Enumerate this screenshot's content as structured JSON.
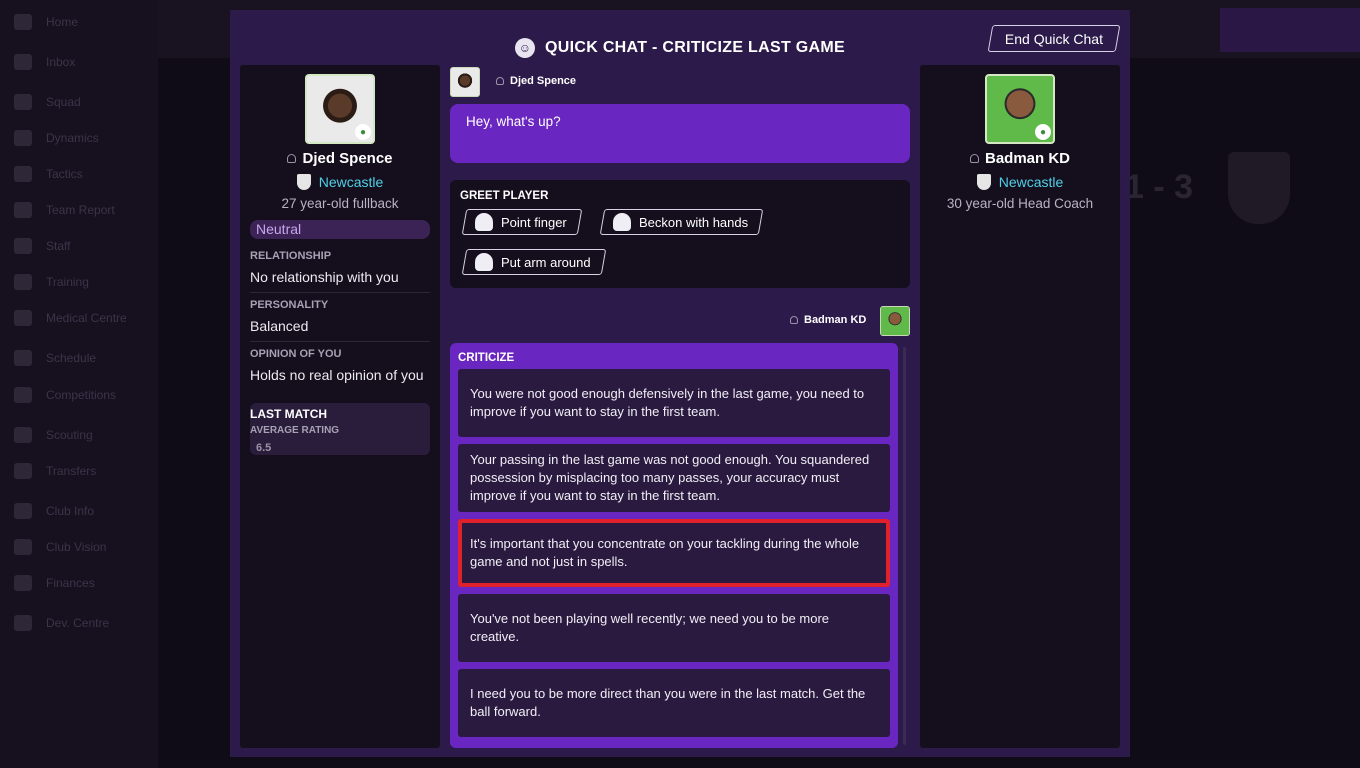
{
  "background": {
    "nav_items": [
      "Home",
      "Inbox",
      "Squad",
      "Dynamics",
      "Tactics",
      "Team Report",
      "Staff",
      "Training",
      "Medical Centre",
      "Schedule",
      "Competitions",
      "Scouting",
      "Transfers",
      "Club Info",
      "Club Vision",
      "Finances",
      "Dev. Centre"
    ],
    "score": "1 - 3"
  },
  "modal": {
    "title": "QUICK CHAT - CRITICIZE LAST GAME",
    "end_button": "End Quick Chat"
  },
  "player": {
    "name": "Djed Spence",
    "club": "Newcastle",
    "description": "27 year-old fullback",
    "mood": "Neutral",
    "relationship_label": "RELATIONSHIP",
    "relationship_value": "No relationship with you",
    "personality_label": "PERSONALITY",
    "personality_value": "Balanced",
    "opinion_label": "OPINION OF YOU",
    "opinion_value": "Holds no real opinion of you",
    "last_match_title": "LAST MATCH",
    "avg_rating_label": "AVERAGE RATING",
    "avg_rating_value": "6.5"
  },
  "manager": {
    "name": "Badman KD",
    "club": "Newcastle",
    "description": "30 year-old Head Coach"
  },
  "chat": {
    "player_speaker": "Djed Spence",
    "player_message": "Hey, what's up?",
    "greet_title": "GREET PLAYER",
    "greet_options": [
      "Point finger",
      "Beckon with hands",
      "Put arm around"
    ],
    "manager_speaker": "Badman KD",
    "criticize_title": "CRITICIZE",
    "criticize_options": [
      "You were not good enough defensively in the last game, you need to improve if you want to stay in the first team.",
      "Your passing in the last game was not good enough. You squandered possession by misplacing too many passes, your accuracy must improve if you want to stay in the first team.",
      "It's important that you concentrate on your tackling during the whole game and not just in spells.",
      "You've not been playing well recently; we need you to be more creative.",
      "I need you to be more direct than you were in the last match. Get the ball forward."
    ]
  },
  "colors": {
    "accent": "#6a26c0",
    "club_link": "#4fd1e8",
    "highlight": "#e0202b"
  }
}
